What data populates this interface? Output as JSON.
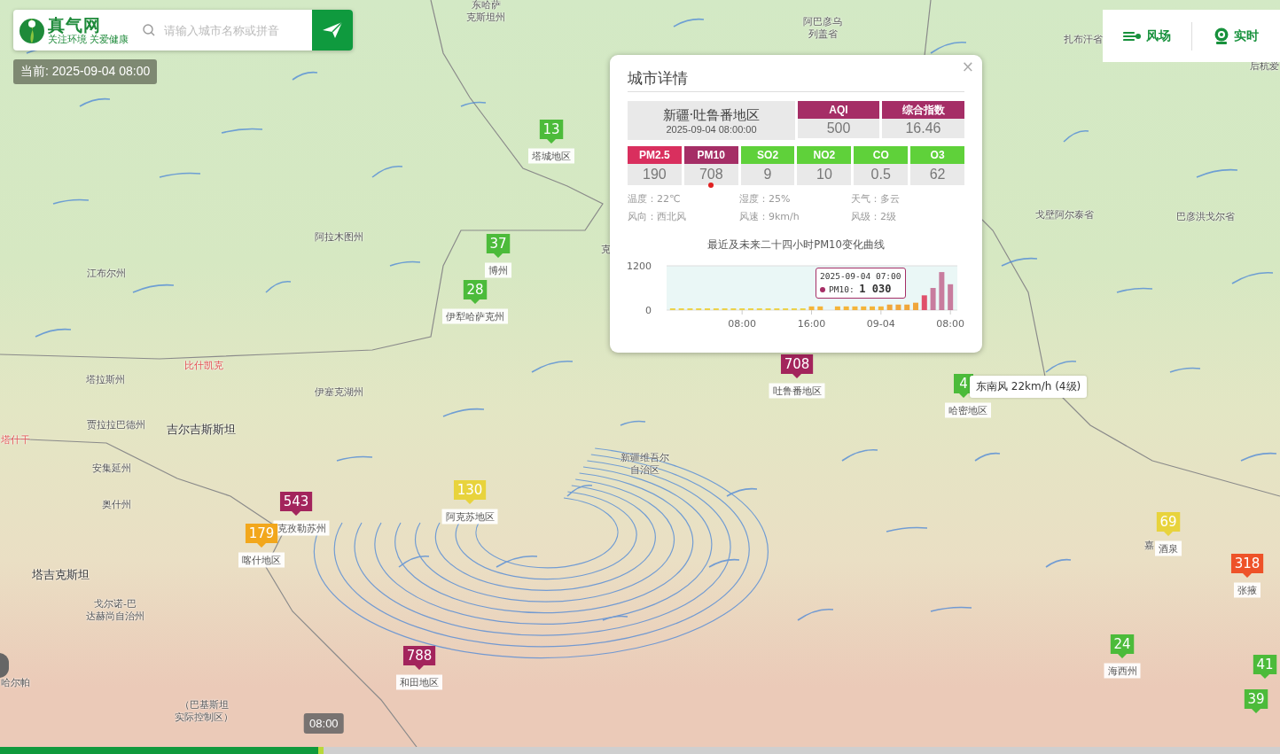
{
  "header": {
    "logo_title": "真气网",
    "logo_tagline": "关注环境 关爱健康",
    "search": {
      "placeholder": "请输入城市名称或拼音"
    }
  },
  "current_time": "当前: 2025-09-04 08:00",
  "toggles": [
    {
      "label": "风场",
      "kind": "wind"
    },
    {
      "label": "实时",
      "kind": "live"
    }
  ],
  "popup": {
    "title": "城市详情",
    "close": "×",
    "city": "新疆·吐鲁番地区",
    "time": "2025-09-04 08:00:00",
    "summary": [
      {
        "label": "AQI",
        "value": "500",
        "color": "#a52e66"
      },
      {
        "label": "综合指数",
        "value": "16.46",
        "color": "#a52e66"
      }
    ],
    "pollutants": [
      {
        "label": "PM2.5",
        "value": "190",
        "color": "#d92f5e",
        "primary": false
      },
      {
        "label": "PM10",
        "value": "708",
        "color": "#a52e66",
        "primary": true
      },
      {
        "label": "SO2",
        "value": "9",
        "color": "#5fd13a",
        "primary": false
      },
      {
        "label": "NO2",
        "value": "10",
        "color": "#5fd13a",
        "primary": false
      },
      {
        "label": "CO",
        "value": "0.5",
        "color": "#5fd13a",
        "primary": false
      },
      {
        "label": "O3",
        "value": "62",
        "color": "#5fd13a",
        "primary": false
      }
    ],
    "weather": [
      "温度：22℃",
      "湿度：25%",
      "天气：多云",
      "风向：西北风",
      "风速：9km/h",
      "风级：2级"
    ],
    "chart_title": "最近及未来二十四小时PM10变化曲线",
    "chart_data": {
      "type": "bar",
      "categories": [
        null,
        null,
        null,
        null,
        null,
        null,
        null,
        null,
        "08:00",
        null,
        null,
        null,
        null,
        null,
        null,
        null,
        "16:00",
        null,
        null,
        null,
        null,
        null,
        null,
        null,
        "09-04",
        null,
        null,
        null,
        null,
        null,
        null,
        null,
        "08:00"
      ],
      "values": [
        40,
        40,
        40,
        40,
        40,
        40,
        40,
        40,
        40,
        40,
        40,
        40,
        40,
        40,
        40,
        40,
        100,
        100,
        null,
        100,
        100,
        100,
        100,
        100,
        100,
        150,
        150,
        150,
        200,
        400,
        600,
        1030,
        700
      ],
      "ylim": [
        0,
        1200
      ],
      "yticks": [
        0,
        1200
      ]
    },
    "tooltip": {
      "time": "2025-09-04 07:00",
      "label": "PM10:",
      "value": "1 030"
    }
  },
  "markers": [
    {
      "value": "13",
      "color": "#4cbb3a",
      "place": "塔城地区"
    },
    {
      "value": "37",
      "color": "#4cbb3a",
      "place": "博州"
    },
    {
      "value": "28",
      "color": "#4cbb3a",
      "place": "伊犁哈萨克州"
    },
    {
      "value": "708",
      "color": "#a3245c",
      "place": "吐鲁番地区"
    },
    {
      "value": "4",
      "color": "#4cbb3a",
      "place": "哈密地区"
    },
    {
      "value": "130",
      "color": "#e8d33c",
      "place": "阿克苏地区"
    },
    {
      "value": "543",
      "color": "#a3245c",
      "place": "克孜勒苏州"
    },
    {
      "value": "179",
      "color": "#f2a71c",
      "place": "喀什地区"
    },
    {
      "value": "69",
      "color": "#e8d33c",
      "place": "酒泉"
    },
    {
      "value": "318",
      "color": "#ee5228",
      "place": "张掖"
    },
    {
      "value": "24",
      "color": "#4cbb3a",
      "place": "海西州"
    },
    {
      "value": "788",
      "color": "#a3245c",
      "place": "和田地区"
    },
    {
      "value": "41",
      "color": "#4cbb3a"
    },
    {
      "value": "39",
      "color": "#4cbb3a"
    }
  ],
  "place_labels": [
    "东哈萨",
    "克斯坦州",
    "阿巴彦乌",
    "列盖省",
    "扎布汗省",
    "后杭爱",
    "阿拉木图州",
    "江布尔州",
    "比什凯克",
    "塔拉斯州",
    "伊塞克湖州",
    "贾拉拉巴德州",
    "吉尔吉斯斯坦",
    "塔什干",
    "安集延州",
    "奥什州",
    "新疆维吾尔",
    "自治区",
    "戈壁阿尔泰省",
    "巴彦洪戈尔省",
    "塔吉克斯坦",
    "戈尔诺-巴",
    "达赫尚自治州",
    "（巴基斯坦",
    "实际控制区）",
    "克",
    "嘉",
    "哈尔帕"
  ],
  "wind_tooltip": "东南风 22km/h (4级)",
  "timeline": {
    "current": "08:00",
    "level": 0.253
  }
}
